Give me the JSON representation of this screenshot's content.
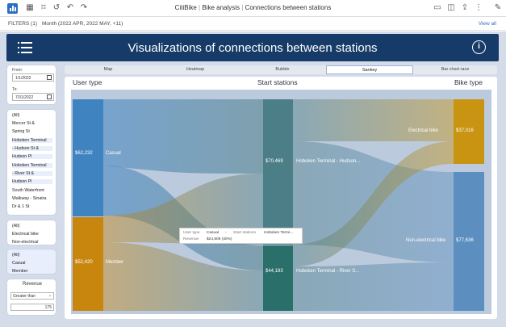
{
  "toolbar": {
    "title_app": "CitiBike",
    "title_sep": "|",
    "title_workbook": "Bike analysis",
    "title_sep2": "|",
    "title_page": "Connections between stations"
  },
  "filters": {
    "label": "FILTERS (1)",
    "value": "Month (2022 APR, 2022 MAY, +11)",
    "view_all": "View all"
  },
  "header": {
    "title": "Visualizations of connections between stations",
    "info": "i"
  },
  "date_filter": {
    "from_label": "From:",
    "from_value": "1/1/2022",
    "to_label": "To:",
    "to_value": "7/31/2022"
  },
  "station_slicer": {
    "items": [
      "(All)",
      "Mercer St &",
      "Spring St",
      "Hoboken Terminal",
      "- Hudson St &",
      "Hudson Pl",
      "Hoboken Terminal",
      "- River St &",
      "Hudson Pl",
      "South Waterfront",
      "Walkway - Sinatra",
      "Dr & 1 St"
    ]
  },
  "bike_slicer": {
    "items": [
      "(All)",
      "Electrical bike",
      "Non-electrical"
    ]
  },
  "user_slicer": {
    "items": [
      "(All)",
      "Casual",
      "Member"
    ]
  },
  "revenue_filter": {
    "title": "Revenue",
    "operator": "Greater than",
    "value": "175"
  },
  "tabs": [
    {
      "label": "Map"
    },
    {
      "label": "Heatmap"
    },
    {
      "label": "Bubble"
    },
    {
      "label": "Sankey"
    },
    {
      "label": "Bar chart race"
    }
  ],
  "sankey": {
    "col_user": "User type",
    "col_start": "Start stations",
    "col_bike": "Bike type",
    "nodes": {
      "casual_value": "$62,232",
      "casual_label": "Casual",
      "member_value": "$52,420",
      "member_label": "Member",
      "hudson_value": "$70,469",
      "hudson_label": "Hoboken Terminal - Hudson...",
      "river_value": "$44,183",
      "river_label": "Hoboken Terminal - River S...",
      "electric_value": "$37,016",
      "electric_label": "Electrical bike",
      "nonelectric_value": "$77,636",
      "nonelectric_label": "Non-electrical bike"
    },
    "colors": {
      "casual": "#3f83c0",
      "member": "#c8860f",
      "hudson": "#4c7e87",
      "river": "#2a6f6a",
      "electric": "#c99412",
      "nonelectric": "#5c8fc0"
    }
  },
  "tooltip": {
    "k1": "User type",
    "v1": "Casual",
    "k2": "Start stations",
    "v2": "Hoboken Termi...",
    "k3": "Revenue",
    "v3": "$24,809 (40%)"
  }
}
